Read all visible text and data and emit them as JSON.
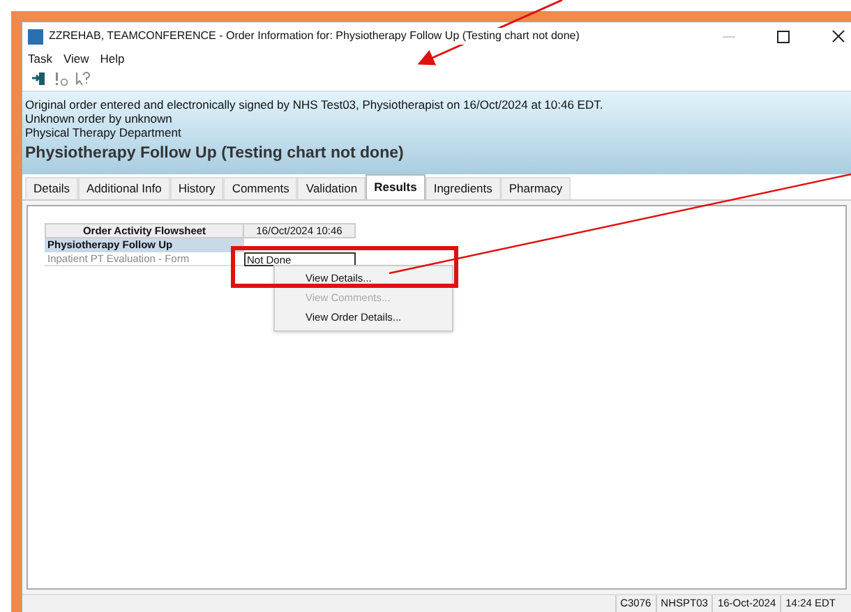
{
  "window": {
    "title": "ZZREHAB, TEAMCONFERENCE - Order Information for: Physiotherapy Follow Up (Testing chart not done)"
  },
  "menu": [
    "Task",
    "View",
    "Help"
  ],
  "header": {
    "lines": [
      "Original order entered and electronically signed by NHS Test03, Physiotherapist on 16/Oct/2024 at 10:46 EDT.",
      "Unknown order by unknown",
      "Physical Therapy Department"
    ],
    "title": "Physiotherapy Follow Up (Testing chart not done)"
  },
  "tabs": [
    {
      "label": "Details",
      "selected": false
    },
    {
      "label": "Additional Info",
      "selected": false
    },
    {
      "label": "History",
      "selected": false
    },
    {
      "label": "Comments",
      "selected": false
    },
    {
      "label": "Validation",
      "selected": false
    },
    {
      "label": "Results",
      "selected": true
    },
    {
      "label": "Ingredients",
      "selected": false
    },
    {
      "label": "Pharmacy",
      "selected": false
    }
  ],
  "flowsheet": {
    "columns": [
      "Order Activity Flowsheet",
      "16/Oct/2024 10:46"
    ],
    "group": "Physiotherapy Follow Up",
    "rows": [
      {
        "label": "Inpatient PT Evaluation - Form",
        "value": "Not Done"
      }
    ]
  },
  "context_menu": [
    {
      "label": "View Details...",
      "disabled": false
    },
    {
      "label": "View Comments...",
      "disabled": true
    },
    {
      "label": "View Order Details...",
      "disabled": false
    }
  ],
  "status_bar": [
    "C3076",
    "NHSPT03",
    "16-Oct-2024",
    "14:24 EDT"
  ]
}
